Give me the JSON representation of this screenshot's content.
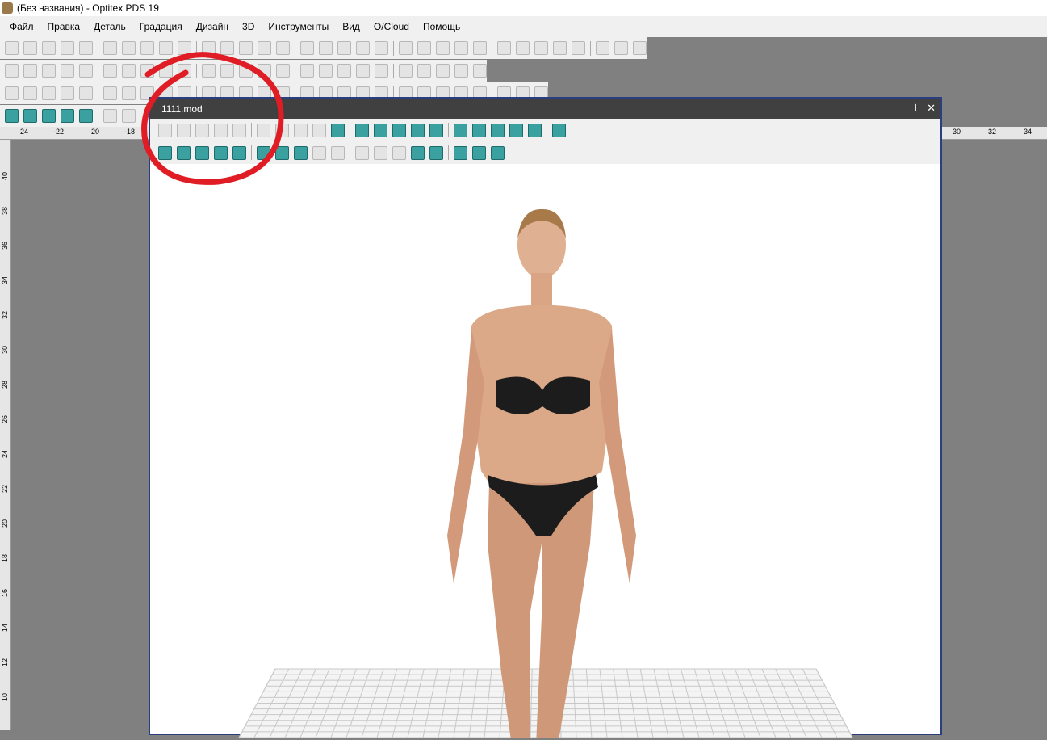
{
  "title": "(Без названия) - Optitex PDS 19",
  "menu": [
    "Файл",
    "Правка",
    "Деталь",
    "Градация",
    "Дизайн",
    "3D",
    "Инструменты",
    "Вид",
    "O/Cloud",
    "Помощь"
  ],
  "toolbars": {
    "row1": [
      "pointer-icon",
      "new-icon",
      "open-icon",
      "save-icon",
      "print-icon",
      "plot-icon",
      "layout-icon",
      "delete-icon",
      "pin-icon",
      "zoom-icon",
      "undo-icon",
      "redo-icon",
      "cut-icon",
      "copy-icon",
      "paste-icon",
      "import-icon",
      "export-icon",
      "help-icon",
      "curve-icon",
      "measure-icon",
      "notch-icon",
      "grade-icon",
      "point-icon",
      "seam-icon",
      "mirror-icon",
      "shape-icon",
      "circle-icon",
      "line-icon",
      "width-icon",
      "style-icon",
      "group-icon",
      "piece-icon",
      "stitch-icon"
    ],
    "row2": [
      "add-point-icon",
      "perp-icon",
      "sew-icon",
      "dart-icon",
      "drill-icon",
      "spiral-icon",
      "text-icon",
      "loop-icon",
      "tack-icon",
      "arc-icon",
      "wave-icon",
      "trash-icon",
      "pen-icon",
      "node-icon",
      "move-icon",
      "fold-icon",
      "rotate-icon",
      "rotate2-icon",
      "flip-icon",
      "symmetry-icon",
      "rect-icon",
      "lock-icon",
      "swap-icon",
      "scale-icon",
      "grid-icon"
    ],
    "row3": [
      "piece1-icon",
      "piece2-icon",
      "piece3-icon",
      "piece4-icon",
      "piece5-icon",
      "piece6-icon",
      "piece7-icon",
      "piece8-icon",
      "piece9-icon",
      "piece10-icon",
      "piece11-icon",
      "piece12-icon",
      "piece13-icon",
      "piece14-icon",
      "piece15-icon",
      "piece16-icon",
      "dart2-icon",
      "magic-icon",
      "square-icon",
      "para-icon",
      "trap-icon",
      "diamond-icon",
      "rhombus-icon",
      "tri-icon",
      "pent-icon",
      "hex-icon",
      "oct-icon",
      "circle2-icon"
    ],
    "row4": [
      "table1-icon",
      "table2-icon",
      "table3-icon",
      "table4-icon",
      "calc-icon",
      "avatar-icon",
      "list-icon"
    ]
  },
  "ruler": {
    "top_left": [
      "-24",
      "-22",
      "-20",
      "-18"
    ],
    "top_right": [
      "30",
      "32",
      "34"
    ],
    "left": [
      "40",
      "38",
      "36",
      "34",
      "32",
      "30",
      "28",
      "26",
      "24",
      "22",
      "20",
      "18",
      "16",
      "14",
      "12",
      "10"
    ]
  },
  "window": {
    "title": "1111.mod",
    "pin": "⊥",
    "close": "✕",
    "tb1": [
      "recycle-icon",
      "remove-cloth-icon",
      "avatar-props-icon",
      "refresh-icon",
      "down-icon",
      "play-icon",
      "cylinder-icon",
      "frame-icon",
      "texture-icon",
      "axes-icon",
      "fabric-icon",
      "tools-icon",
      "ruler-icon",
      "display-icon",
      "avatar-folder-icon",
      "avatar-key-icon",
      "mesh1-icon",
      "mesh2-icon",
      "mesh3-icon",
      "monitor-icon",
      "shirt-icon"
    ],
    "tb2": [
      "select-icon",
      "front-view-icon",
      "left-view-icon",
      "right-view-icon",
      "back-view-icon",
      "top-view-icon",
      "bottom-view-icon",
      "add-view-icon",
      "hook-icon",
      "hand-icon",
      "pin2-icon",
      "pattern-icon",
      "link-icon",
      "sphere-icon",
      "shade-icon",
      "light-icon",
      "scene-icon",
      "camera-icon"
    ]
  },
  "colors": {
    "annotation": "#e01c24",
    "frame": "#2a3f80"
  }
}
